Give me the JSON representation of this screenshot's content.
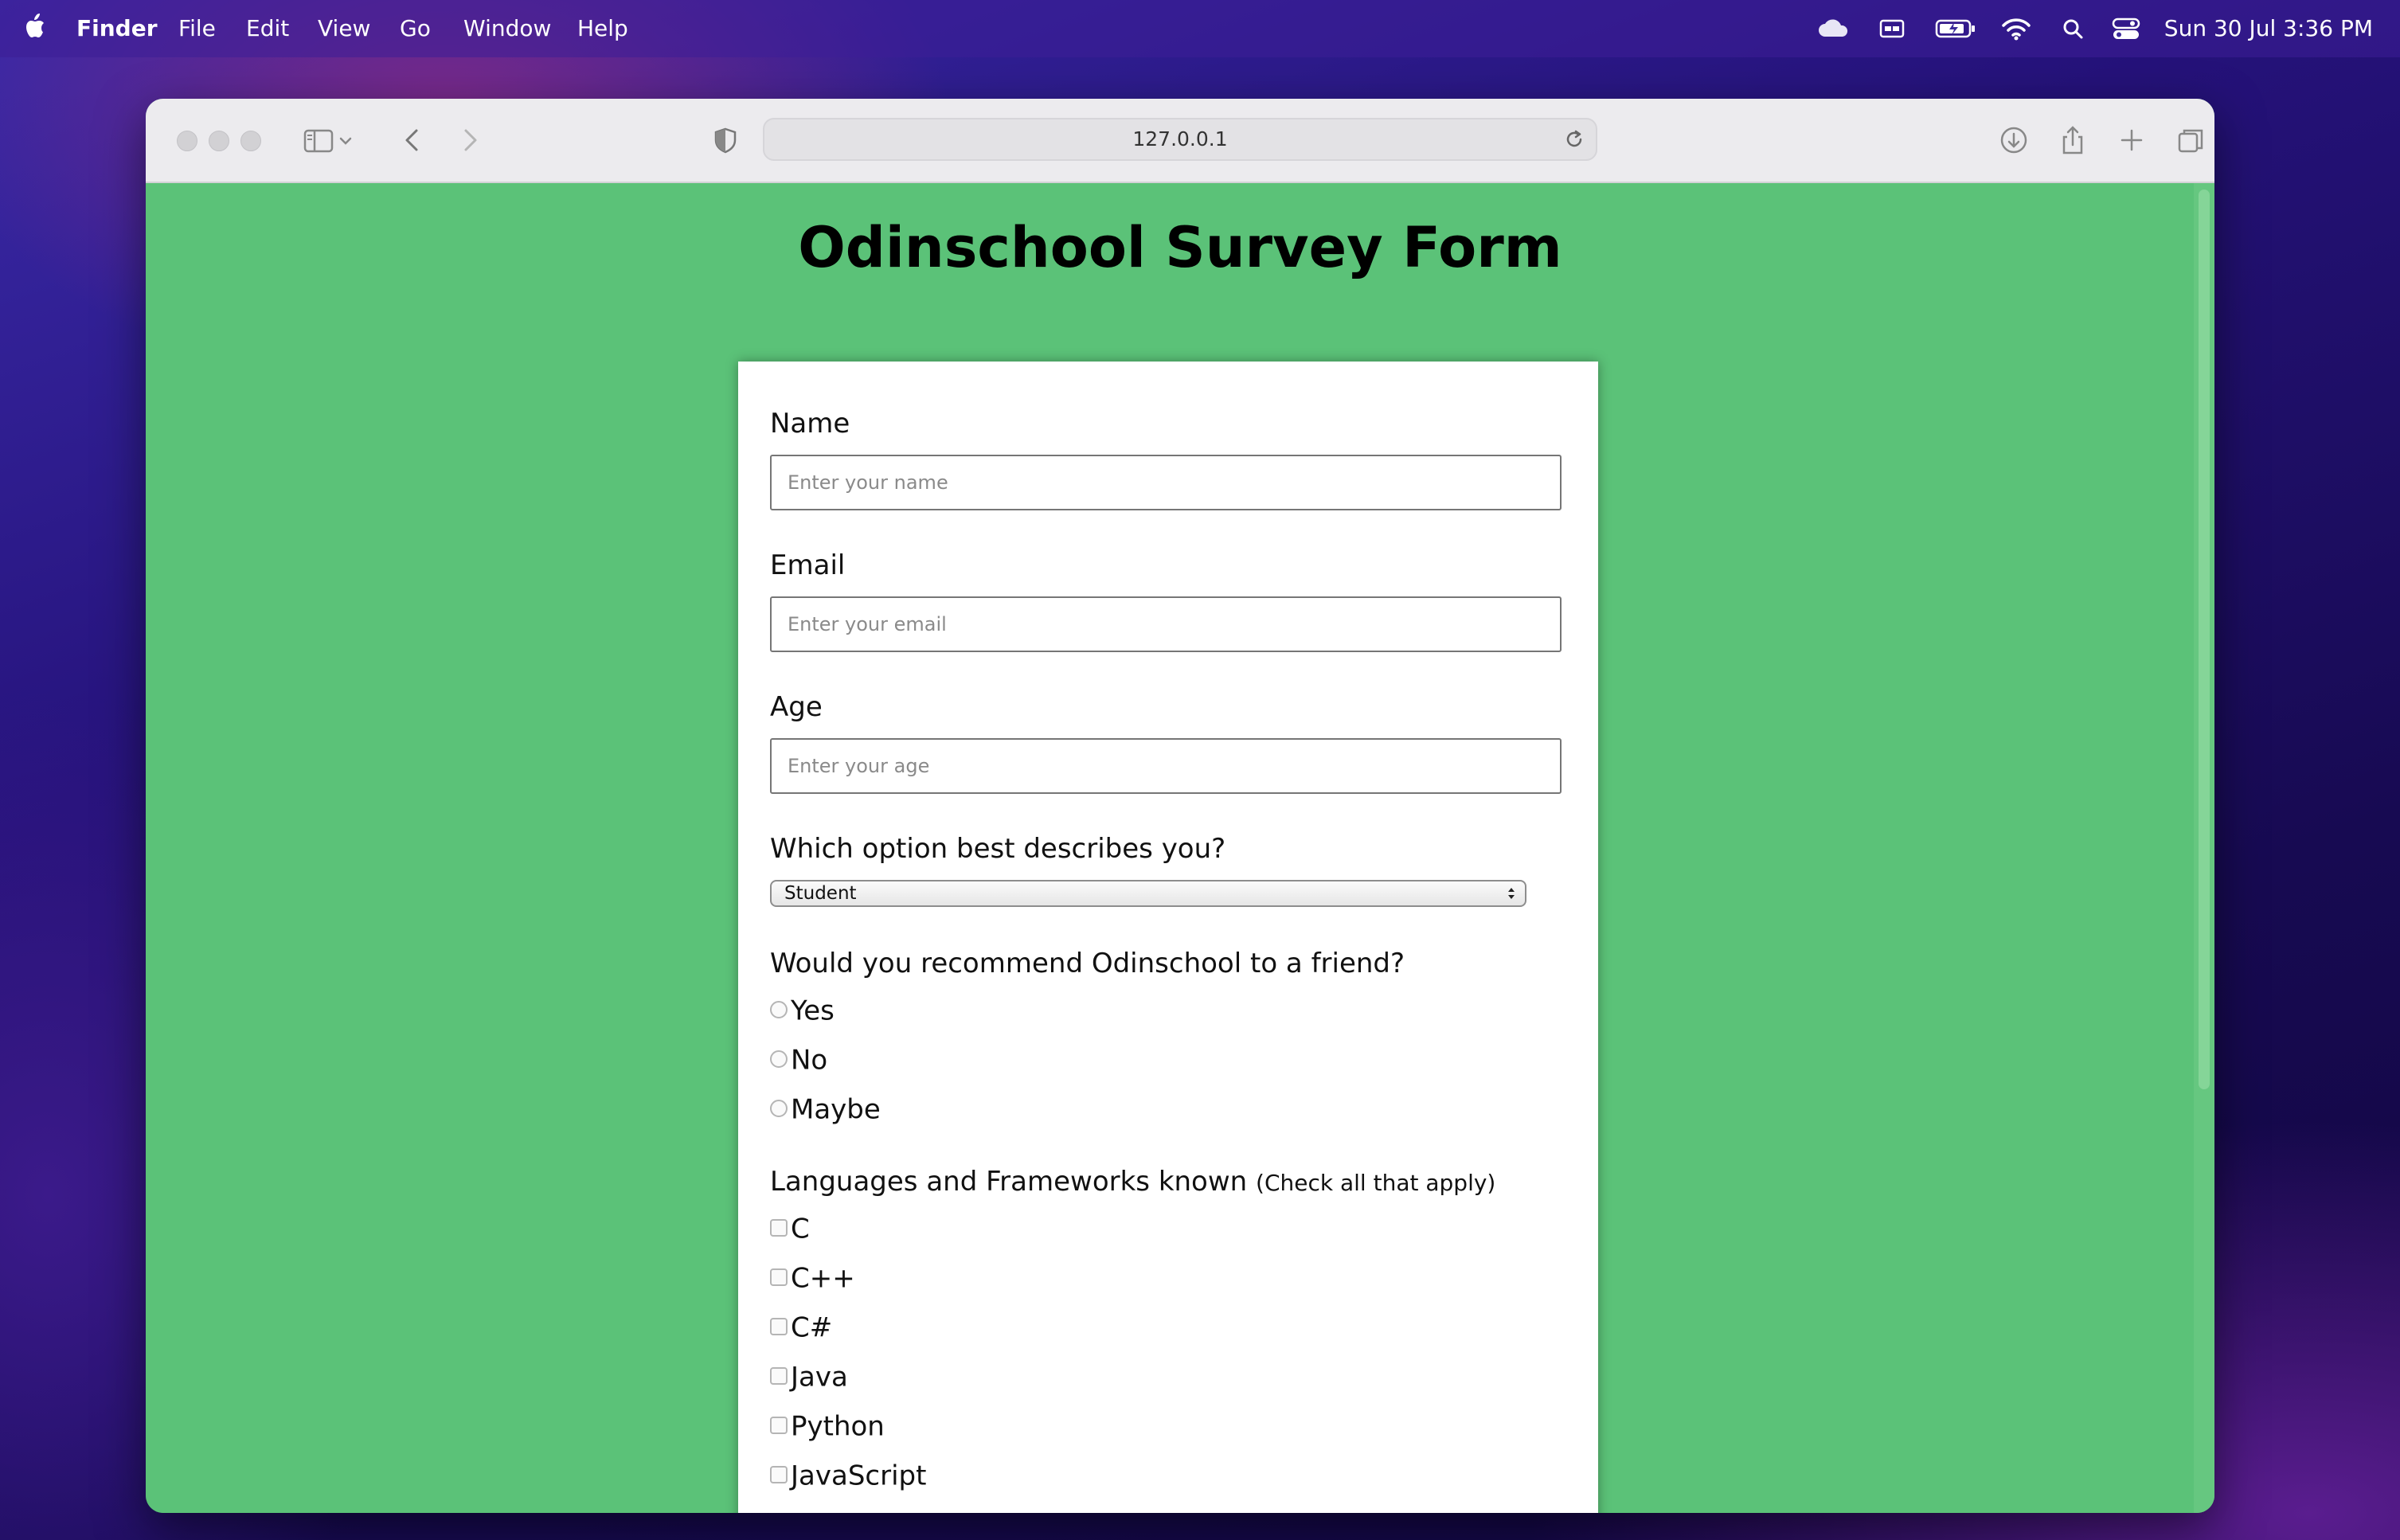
{
  "menubar": {
    "app_name": "Finder",
    "items": [
      "File",
      "Edit",
      "View",
      "Go",
      "Window",
      "Help"
    ],
    "clock": "Sun 30 Jul  3:36 PM",
    "tray_icons": [
      "cloud-icon",
      "display-icon",
      "battery-icon",
      "wifi-icon",
      "spotlight-search-icon",
      "control-center-icon"
    ]
  },
  "browser": {
    "url": "127.0.0.1"
  },
  "page": {
    "title": "Odinschool Survey Form",
    "background_color": "#5bc278",
    "form": {
      "name_label": "Name",
      "name_placeholder": "Enter your name",
      "email_label": "Email",
      "email_placeholder": "Enter your email",
      "age_label": "Age",
      "age_placeholder": "Enter your age",
      "role_label": "Which option best describes you?",
      "role_selected": "Student",
      "recommend_label": "Would you recommend Odinschool to a friend?",
      "recommend_options": [
        "Yes",
        "No",
        "Maybe"
      ],
      "languages_label": "Languages and Frameworks known",
      "languages_hint": "(Check all that apply)",
      "languages_options": [
        "C",
        "C++",
        "C#",
        "Java",
        "Python",
        "JavaScript"
      ]
    }
  }
}
